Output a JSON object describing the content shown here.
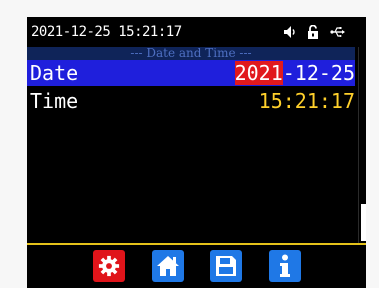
{
  "status_bar": {
    "datetime": "2021-12-25 15:21:17",
    "icons": [
      "speaker-icon",
      "unlock-icon",
      "usb-icon"
    ]
  },
  "section": {
    "header": "--- Date and Time ---"
  },
  "rows": {
    "date": {
      "label": "Date",
      "year": "2021",
      "rest": "-12-25"
    },
    "time": {
      "label": "Time",
      "value": "15:21:17"
    }
  },
  "toolbar": {
    "buttons": [
      "settings-icon",
      "home-icon",
      "save-icon",
      "info-icon"
    ]
  },
  "colors": {
    "selected_row": "#1f1fdc",
    "year_highlight": "#e1191d",
    "time_value": "#ffd02b",
    "header_bg": "#0f2459",
    "divider": "#e4c21a",
    "settings_button": "#e0141a",
    "nav_button": "#1f78e6"
  }
}
